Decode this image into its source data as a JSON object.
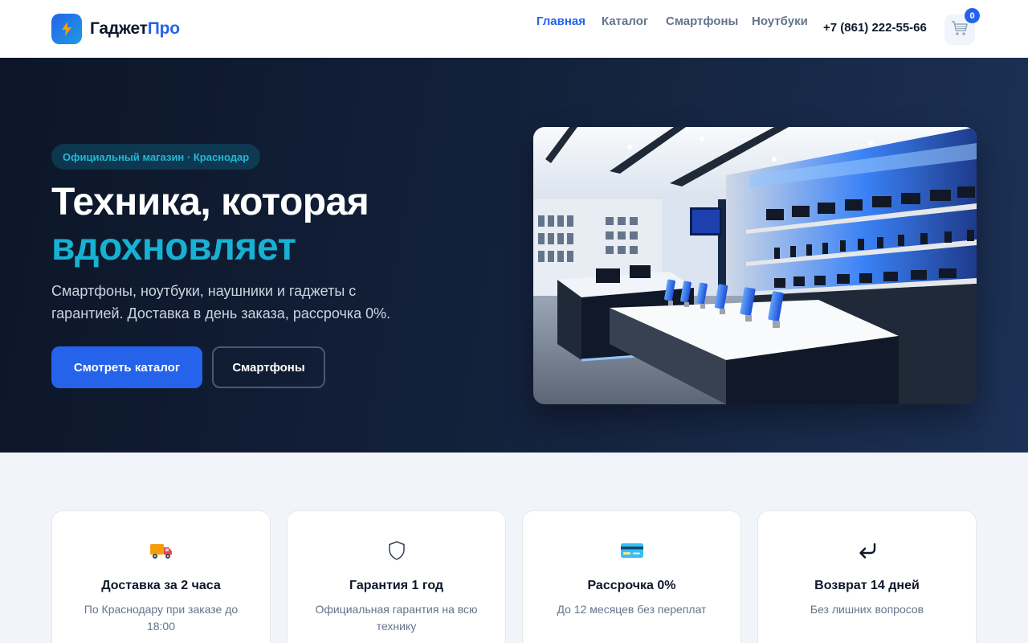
{
  "brand": {
    "name_main": "Гаджет",
    "name_accent": "Про",
    "accent_color": "#2563eb"
  },
  "nav": {
    "items": [
      {
        "label": "Главная",
        "active": true
      },
      {
        "label": "Каталог",
        "active": false
      },
      {
        "label": "Смартфоны",
        "active": false
      },
      {
        "label": "Ноутбуки",
        "active": false
      }
    ],
    "phone": "+7 (861) 222-55-66",
    "cart_count": "0"
  },
  "hero": {
    "badge": "Официальный магазин · Краснодар",
    "title_line1": "Техника, которая",
    "title_line2": "вдохновляет",
    "subtitle": "Смартфоны, ноутбуки, наушники и гаджеты с гарантией. Доставка в день заказа, рассрочка 0%.",
    "primary_button": "Смотреть каталог",
    "secondary_button": "Смартфоны",
    "image_icon": "electronics-store-interior-image"
  },
  "features": [
    {
      "icon": "delivery-truck-icon",
      "title": "Доставка за 2 часа",
      "desc": "По Краснодару при заказе до 18:00"
    },
    {
      "icon": "shield-icon",
      "title": "Гарантия 1 год",
      "desc": "Официальная гарантия на всю технику"
    },
    {
      "icon": "credit-card-icon",
      "title": "Рассрочка 0%",
      "desc": "До 12 месяцев без переплат"
    },
    {
      "icon": "return-arrow-icon",
      "title": "Возврат 14 дней",
      "desc": "Без лишних вопросов"
    }
  ]
}
